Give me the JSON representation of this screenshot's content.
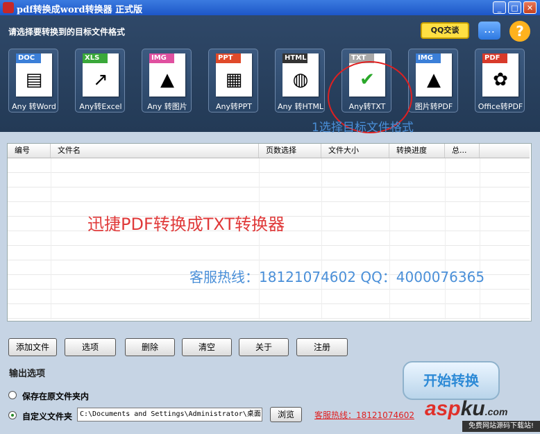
{
  "window": {
    "title": "pdf转换成word转换器 正式版",
    "minimize": "_",
    "maximize": "□",
    "close": "✕"
  },
  "header": {
    "instruction": "请选择要转换到的目标文件格式",
    "qq_button": "QQ交谈",
    "chat_icon": "…",
    "help_icon": "?"
  },
  "formats": [
    {
      "tag": "DOC",
      "label": "Any 转Word",
      "tag_color": "#3b7fd8",
      "glyph": "▤"
    },
    {
      "tag": "XLS",
      "label": "Any转Excel",
      "tag_color": "#3aa83a",
      "glyph": "↗"
    },
    {
      "tag": "IMG",
      "label": "Any 转图片",
      "tag_color": "#e050a0",
      "glyph": "▲"
    },
    {
      "tag": "PPT",
      "label": "Any转PPT",
      "tag_color": "#e04a2a",
      "glyph": "▦"
    },
    {
      "tag": "HTML",
      "label": "Any 转HTML",
      "tag_color": "#333333",
      "glyph": "◍"
    },
    {
      "tag": "TXT",
      "label": "Any转TXT",
      "tag_color": "#a8a8a8",
      "glyph": "✔"
    },
    {
      "tag": "IMG",
      "label": "图片转PDF",
      "tag_color": "#3b7fd8",
      "glyph": "▲"
    },
    {
      "tag": "PDF",
      "label": "Office转PDF",
      "tag_color": "#d83a2a",
      "glyph": "✿"
    }
  ],
  "hint": "1选择目标文件格式",
  "table": {
    "columns": [
      "编号",
      "文件名",
      "页数选择",
      "文件大小",
      "转换进度",
      "总..."
    ],
    "watermark_title": "迅捷PDF转换成TXT转换器",
    "watermark_contact": "客服热线：18121074602 QQ：4000076365"
  },
  "buttons": {
    "add": "添加文件",
    "options": "选项",
    "delete": "删除",
    "clear": "清空",
    "about": "关于",
    "register": "注册"
  },
  "output": {
    "label": "输出选项",
    "option_original": "保存在原文件夹内",
    "option_custom": "自定义文件夹",
    "path": "C:\\Documents and Settings\\Administrator\\桌面",
    "browse": "浏览",
    "hotline": "客服热线：18121074602"
  },
  "start_button": "开始转换",
  "watermark": {
    "brand_a": "asp",
    "brand_b": "ku",
    "brand_c": ".com",
    "sub": "免费网站源码下载站!"
  }
}
